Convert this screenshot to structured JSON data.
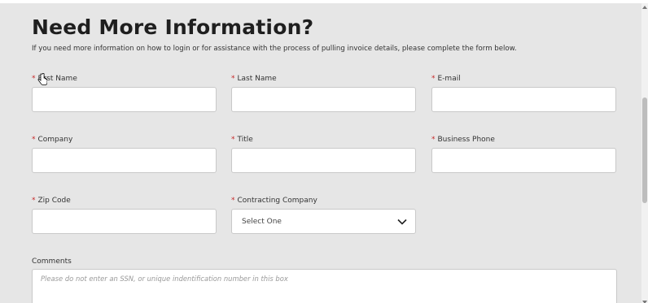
{
  "heading": "Need More Information?",
  "intro": "If you need more information on how to login or for assistance with the process of pulling invoice details, please complete the form below.",
  "required_marker": "*",
  "fields": {
    "first_name": {
      "label": "First Name",
      "value": ""
    },
    "last_name": {
      "label": "Last Name",
      "value": ""
    },
    "email": {
      "label": "E-mail",
      "value": ""
    },
    "company": {
      "label": "Company",
      "value": ""
    },
    "title": {
      "label": "Title",
      "value": ""
    },
    "business_phone": {
      "label": "Business Phone",
      "value": ""
    },
    "zip_code": {
      "label": "Zip Code",
      "value": ""
    },
    "contracting_company": {
      "label": "Contracting Company",
      "selected": "Select One"
    }
  },
  "comments": {
    "label": "Comments",
    "placeholder": "Please do not enter an SSN, or unique indentification number in this box"
  },
  "colors": {
    "background": "#e6e6e6",
    "required": "#c62828",
    "input_border": "#c9c9c9"
  }
}
